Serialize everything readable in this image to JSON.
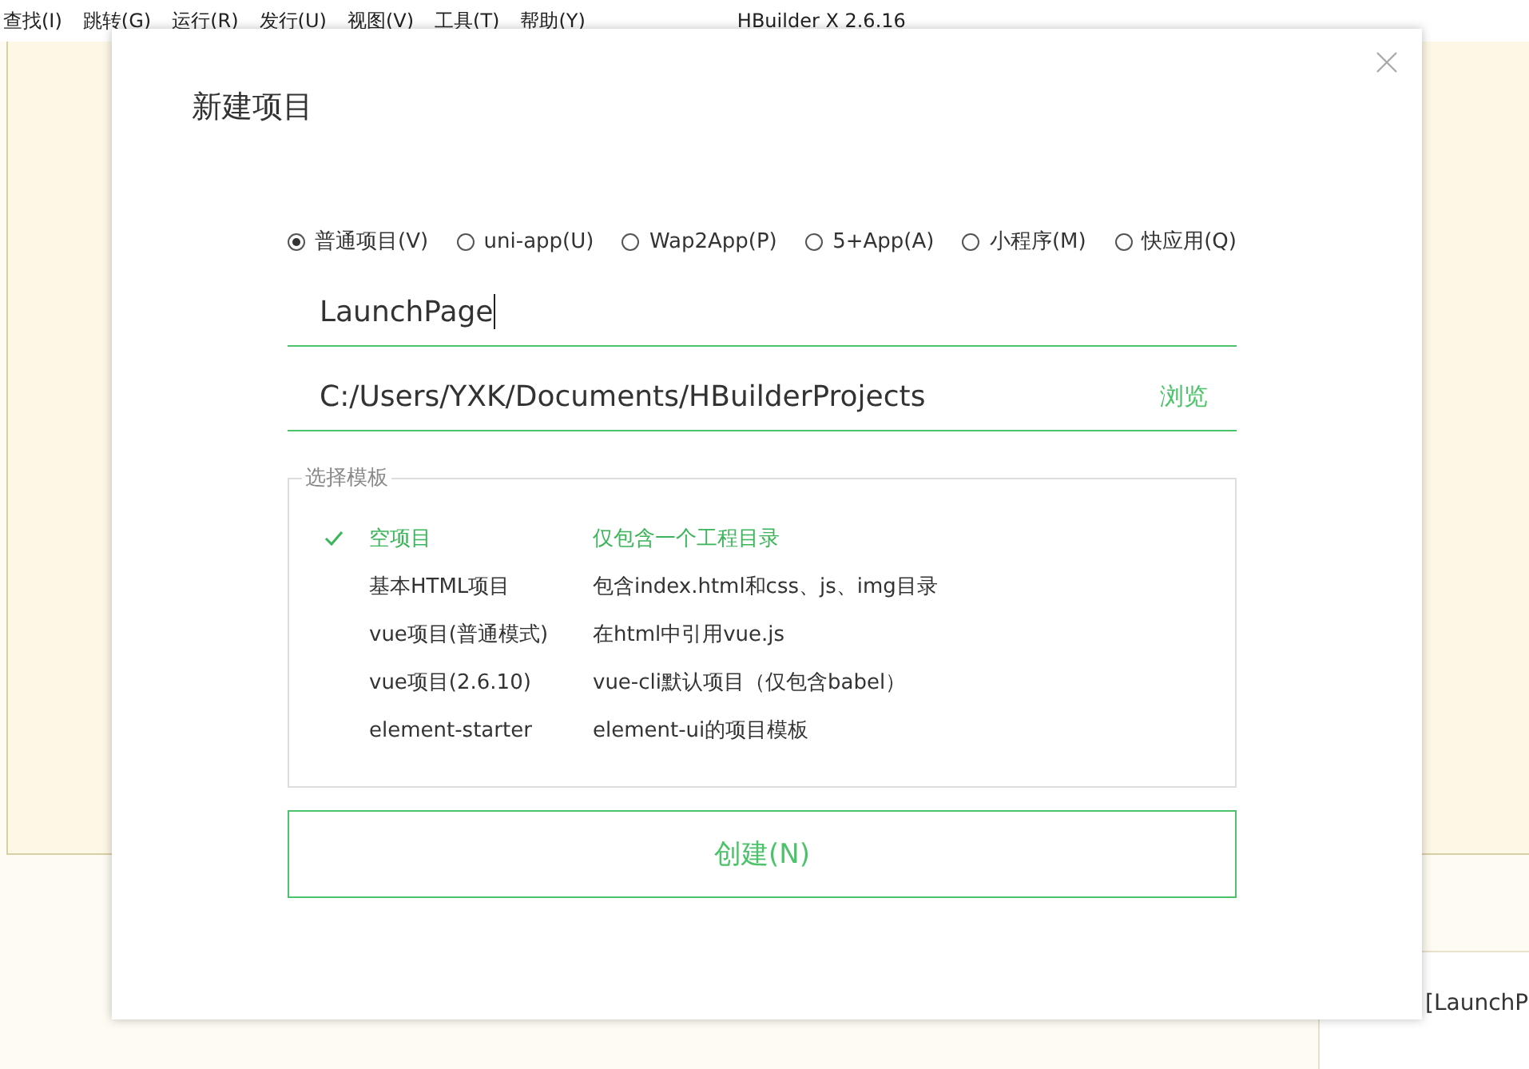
{
  "menu": [
    "查找(I)",
    "跳转(G)",
    "运行(R)",
    "发行(U)",
    "视图(V)",
    "工具(T)",
    "帮助(Y)"
  ],
  "app_title": "HBuilder X 2.6.16",
  "dialog": {
    "title": "新建项目",
    "project_types": [
      {
        "label": "普通项目(V)",
        "selected": true
      },
      {
        "label": "uni-app(U)",
        "selected": false
      },
      {
        "label": "Wap2App(P)",
        "selected": false
      },
      {
        "label": "5+App(A)",
        "selected": false
      },
      {
        "label": "小程序(M)",
        "selected": false
      },
      {
        "label": "快应用(Q)",
        "selected": false
      }
    ],
    "name_field": {
      "value": "LaunchPage"
    },
    "location_field": {
      "value": "C:/Users/YXK/Documents/HBuilderProjects",
      "browse": "浏览"
    },
    "template_group": {
      "legend": "选择模板",
      "templates": [
        {
          "name": "空项目",
          "description": "仅包含一个工程目录",
          "selected": true
        },
        {
          "name": "基本HTML项目",
          "description": "包含index.html和css、js、img目录",
          "selected": false
        },
        {
          "name": "vue项目(普通模式)",
          "description": "在html中引用vue.js",
          "selected": false
        },
        {
          "name": "vue项目(2.6.10)",
          "description": "vue-cli默认项目（仅包含babel）",
          "selected": false
        },
        {
          "name": "element-starter",
          "description": "element-ui的项目模板",
          "selected": false
        }
      ]
    },
    "create_button": "创建(N)"
  },
  "background_popup": {
    "text": "[LaunchP"
  }
}
